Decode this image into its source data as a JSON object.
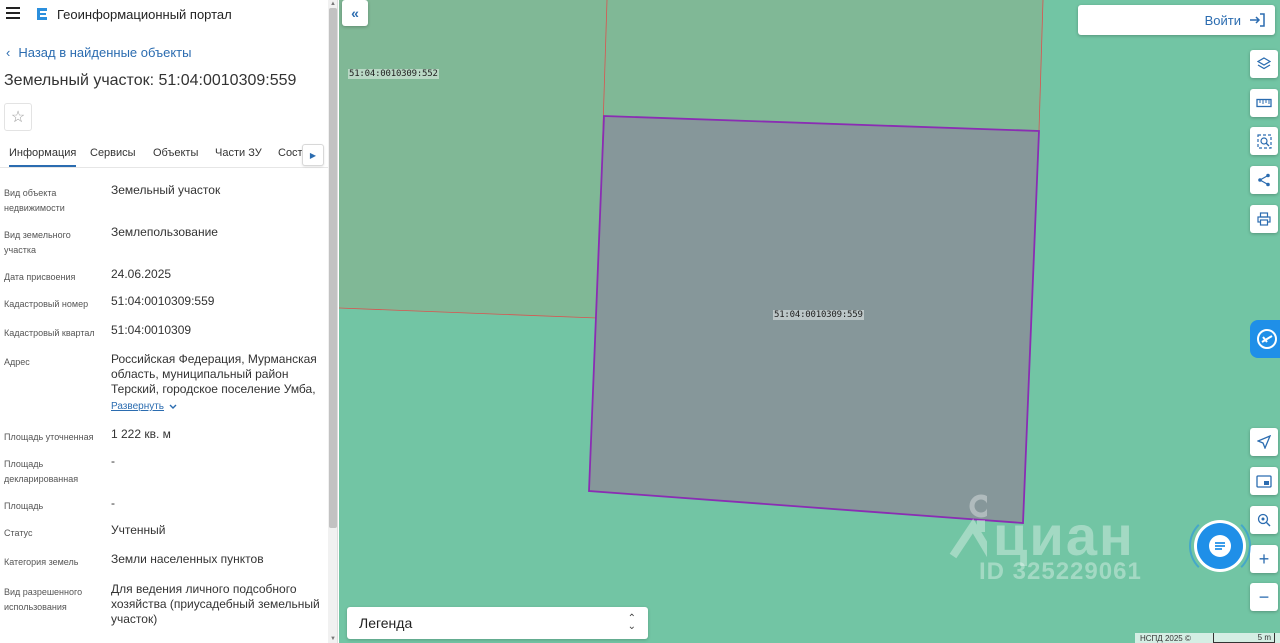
{
  "app": {
    "title": "Геоинформационный портал"
  },
  "nav": {
    "back_label": "Назад в найденные объекты"
  },
  "object": {
    "title": "Земельный участок: 51:04:0010309:559"
  },
  "tabs": [
    {
      "label": "Информация",
      "active": true
    },
    {
      "label": "Сервисы",
      "active": false
    },
    {
      "label": "Объекты",
      "active": false
    },
    {
      "label": "Части ЗУ",
      "active": false
    },
    {
      "label": "Состав",
      "active": false
    }
  ],
  "info": [
    {
      "label": "Вид объекта недвижимости",
      "value": "Земельный участок"
    },
    {
      "label": "Вид земельного участка",
      "value": "Землепользование"
    },
    {
      "label": "Дата присвоения",
      "value": "24.06.2025"
    },
    {
      "label": "Кадастровый номер",
      "value": "51:04:0010309:559"
    },
    {
      "label": "Кадастровый квартал",
      "value": "51:04:0010309"
    },
    {
      "label": "Адрес",
      "value": "Российская Федерация, Мурманская область, муниципальный район Терский, городское поселение Умба,",
      "expand_label": "Развернуть"
    },
    {
      "label": "Площадь уточненная",
      "value": "1 222 кв. м"
    },
    {
      "label": "Площадь декларированная",
      "value": "-"
    },
    {
      "label": "Площадь",
      "value": "-"
    },
    {
      "label": "Статус",
      "value": "Учтенный"
    },
    {
      "label": "Категория земель",
      "value": "Земли населенных пунктов"
    },
    {
      "label": "Вид разрешенного использования",
      "value": "Для ведения личного подсобного хозяйства (приусадебный земельный участок)"
    }
  ],
  "map": {
    "login_label": "Войти",
    "legend_label": "Легенда",
    "parcel_labels": {
      "neighbor": "51:04:0010309:552",
      "selected": "51:04:0010309:559"
    },
    "watermark": {
      "brand": "циан",
      "id_text": "ID 325229061"
    },
    "footer": {
      "copyright": "НСПД 2025 ©",
      "scale": "5 m"
    },
    "colors": {
      "land": "#72c5a4",
      "neighbor_fill": "#80b896",
      "selected_fill": "#86979a",
      "selected_stroke": "#8a2db3",
      "boundary": "#d9534f",
      "accent": "#2b6cb0"
    },
    "tools": [
      "layers-icon",
      "ruler-icon",
      "area-select-icon",
      "share-icon",
      "print-icon"
    ],
    "nav_tools": [
      "locate-icon",
      "minimap-icon",
      "geo-search-icon",
      "zoom-in-icon",
      "zoom-out-icon"
    ]
  }
}
